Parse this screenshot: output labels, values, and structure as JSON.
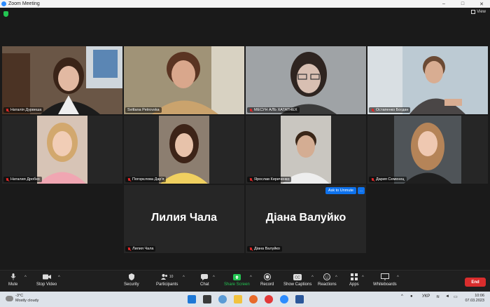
{
  "window": {
    "title": "Zoom Meeting",
    "minimize": "–",
    "maximize": "□",
    "close": "✕"
  },
  "view": {
    "label": "View"
  },
  "participants": [
    {
      "name": "Наталія Дурвеша",
      "muted": true,
      "bg": "#7a6a58",
      "face": "#e2b9a2"
    },
    {
      "name": "Svitlana Petrovska",
      "muted": false,
      "active": true,
      "bg": "#9a8b70",
      "face": "#d9a78c"
    },
    {
      "name": "МЕСУН АЛЬ ХАТАТНЕХ",
      "muted": true,
      "bg": "#8a8e92",
      "face": "#d8bfb2"
    },
    {
      "name": "Остапенко Богдан",
      "muted": true,
      "bg": "#b7c6d0",
      "face": "#d8ad92"
    },
    {
      "name": "Наталия Дробко",
      "muted": true,
      "bg": "#d7c4b6",
      "face": "#f1cdb6"
    },
    {
      "name": "Погорєлова Дар'я",
      "muted": true,
      "bg": "#8c7e70",
      "face": "#e7c2aa"
    },
    {
      "name": "Ярослав Кириченко",
      "muted": true,
      "bg": "#c9c6c0",
      "face": "#d4ad93"
    },
    {
      "name": "Дария Семенец",
      "muted": true,
      "bg": "#4f5458",
      "face": "#efc8b1"
    },
    {
      "name": "Лилия Чала",
      "muted": true,
      "avatar_text": "Лилия Чала"
    },
    {
      "name": "Діана Валуйко",
      "muted": true,
      "avatar_text": "Діана Валуйко",
      "ask_to_unmute": "Ask to Unmute",
      "more": "…"
    }
  ],
  "toolbar": {
    "mute": "Mute",
    "stop_video": "Stop Video",
    "security": "Security",
    "participants": "Participants",
    "participants_count": "10",
    "chat": "Chat",
    "share_screen": "Share Screen",
    "record": "Record",
    "show_captions": "Show Captions",
    "reactions": "Reactions",
    "apps": "Apps",
    "whiteboards": "Whiteboards",
    "end": "End",
    "share_color": "#23c552",
    "end_color": "#d92d2d"
  },
  "taskbar": {
    "temp": "-3°C",
    "weather": "Mostly cloudy",
    "lang": "УКР",
    "time": "10:06",
    "date": "07.03.2023"
  }
}
